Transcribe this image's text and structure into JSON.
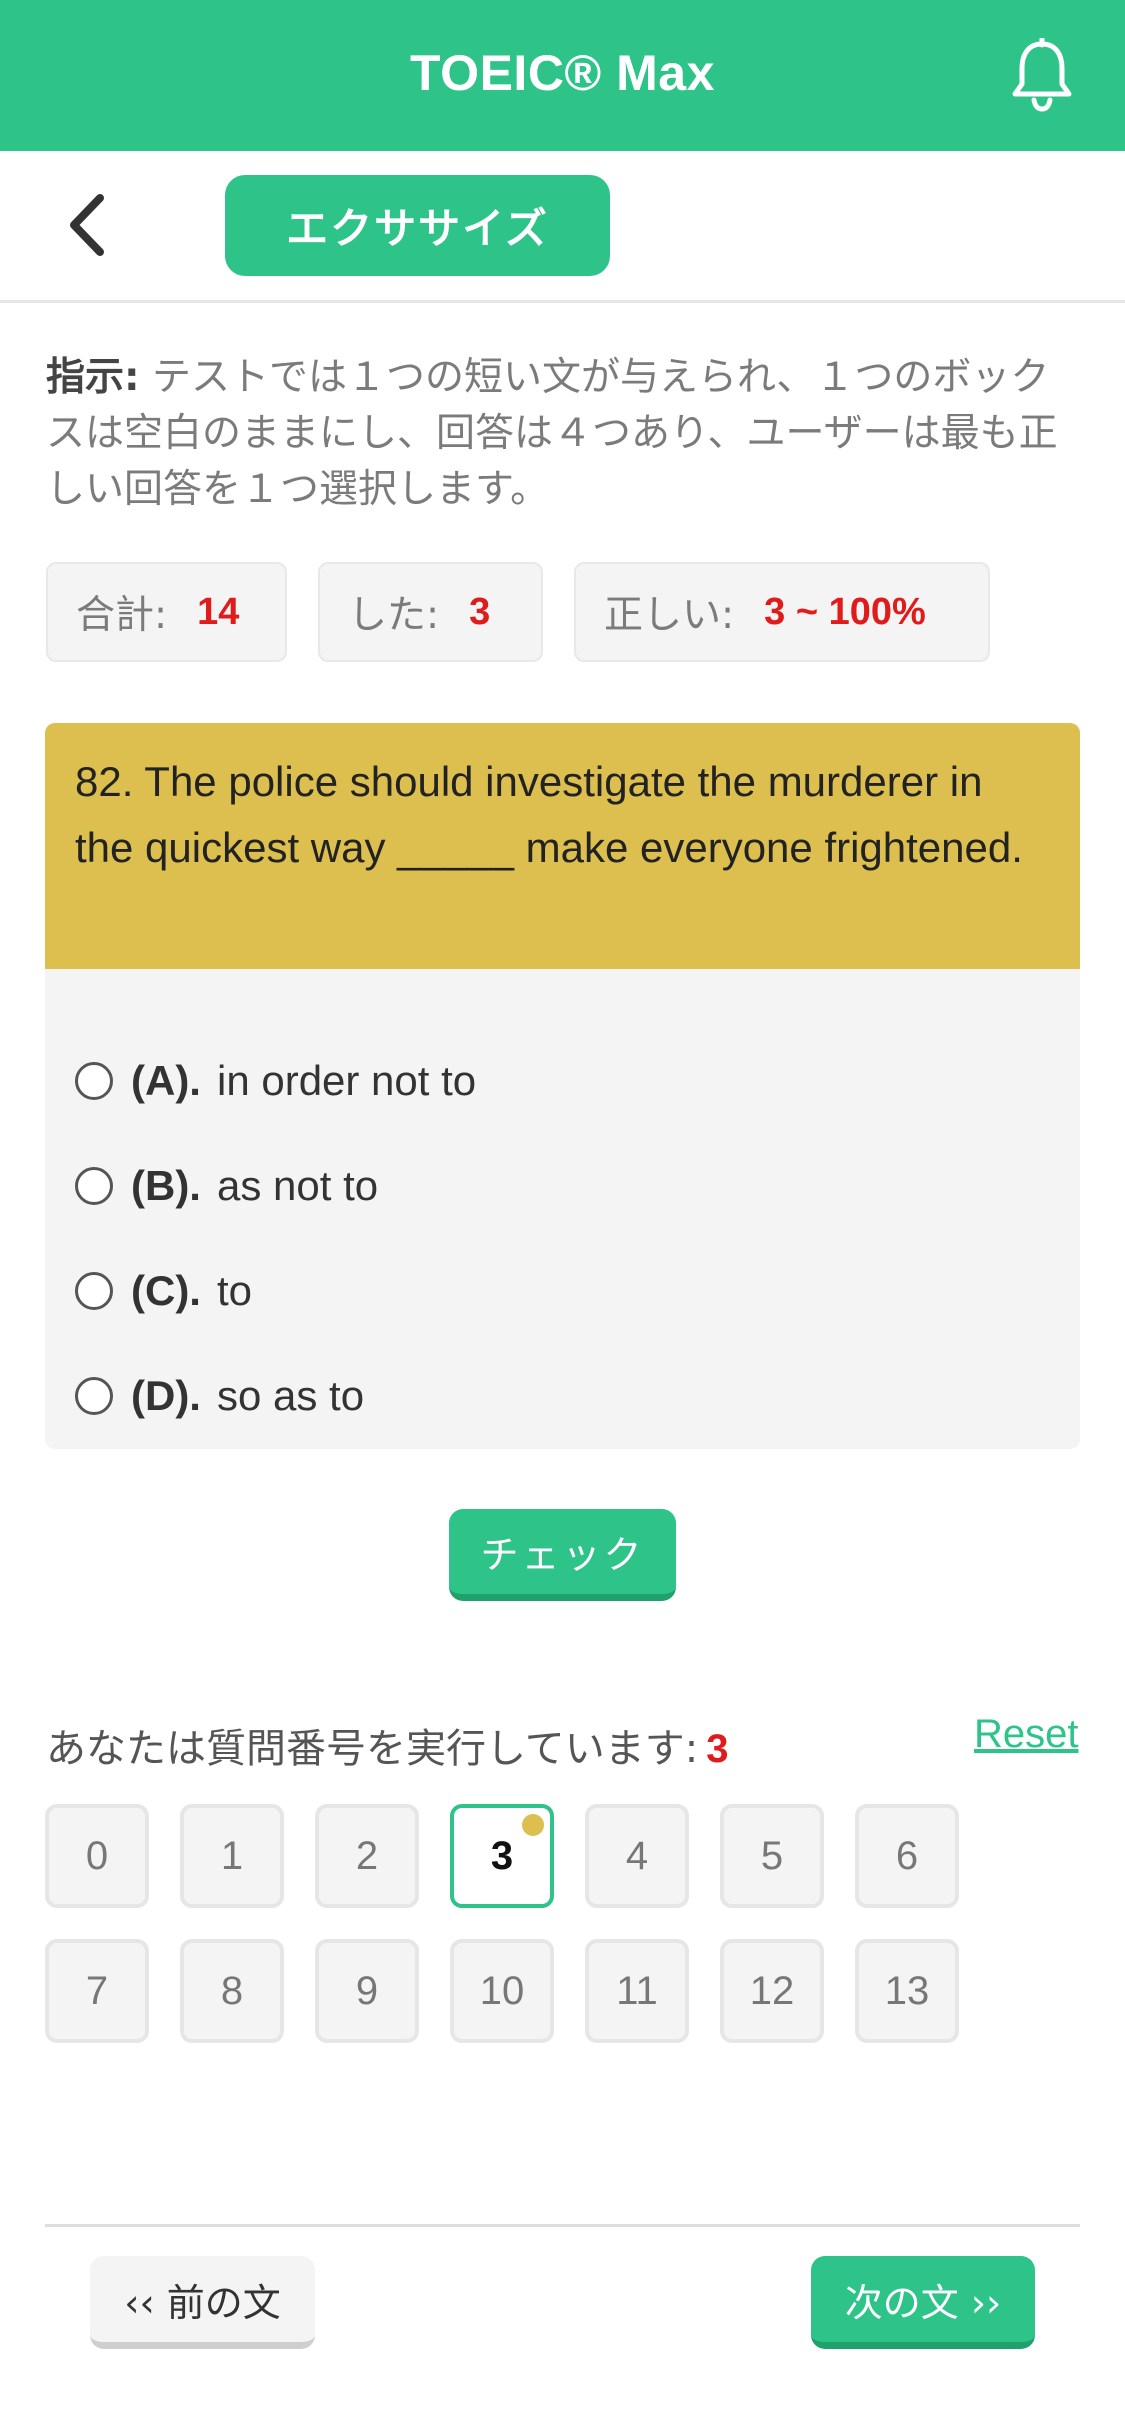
{
  "appbar": {
    "title": "TOEIC® Max",
    "bell_icon": "bell-icon"
  },
  "subheader": {
    "back_icon": "chevron-left-icon",
    "tab_label": "エクササイズ"
  },
  "instructions": {
    "lead": "指示:",
    "text": " テストでは１つの短い文が与えられ、１つのボックスは空白のままにし、回答は４つあり、ユーザーは最も正しい回答を１つ選択します。"
  },
  "stats": {
    "total_label": "合計:",
    "total_value": "14",
    "done_label": "した:",
    "done_value": "3",
    "correct_label": "正しい:",
    "correct_value": "3 ~ 100%"
  },
  "question": {
    "text": "82. The police should investigate the murderer in the quickest way _____ make everyone frightened."
  },
  "options": [
    {
      "letter": "(A).",
      "text": "in order not to"
    },
    {
      "letter": "(B).",
      "text": "as not to"
    },
    {
      "letter": "(C).",
      "text": "to"
    },
    {
      "letter": "(D).",
      "text": "so as to"
    }
  ],
  "check_label": "チェック",
  "progress": {
    "label": "あなたは質問番号を実行しています:",
    "current": "3",
    "reset_label": "Reset"
  },
  "grid": [
    "0",
    "1",
    "2",
    "3",
    "4",
    "5",
    "6",
    "7",
    "8",
    "9",
    "10",
    "11",
    "12",
    "13"
  ],
  "colors": {
    "accent": "#2ec489",
    "question_bg": "#dcbf4e",
    "highlight": "#e01b1b"
  },
  "footer": {
    "prev_label": "‹‹ 前の文",
    "next_label": "次の文 ››"
  }
}
